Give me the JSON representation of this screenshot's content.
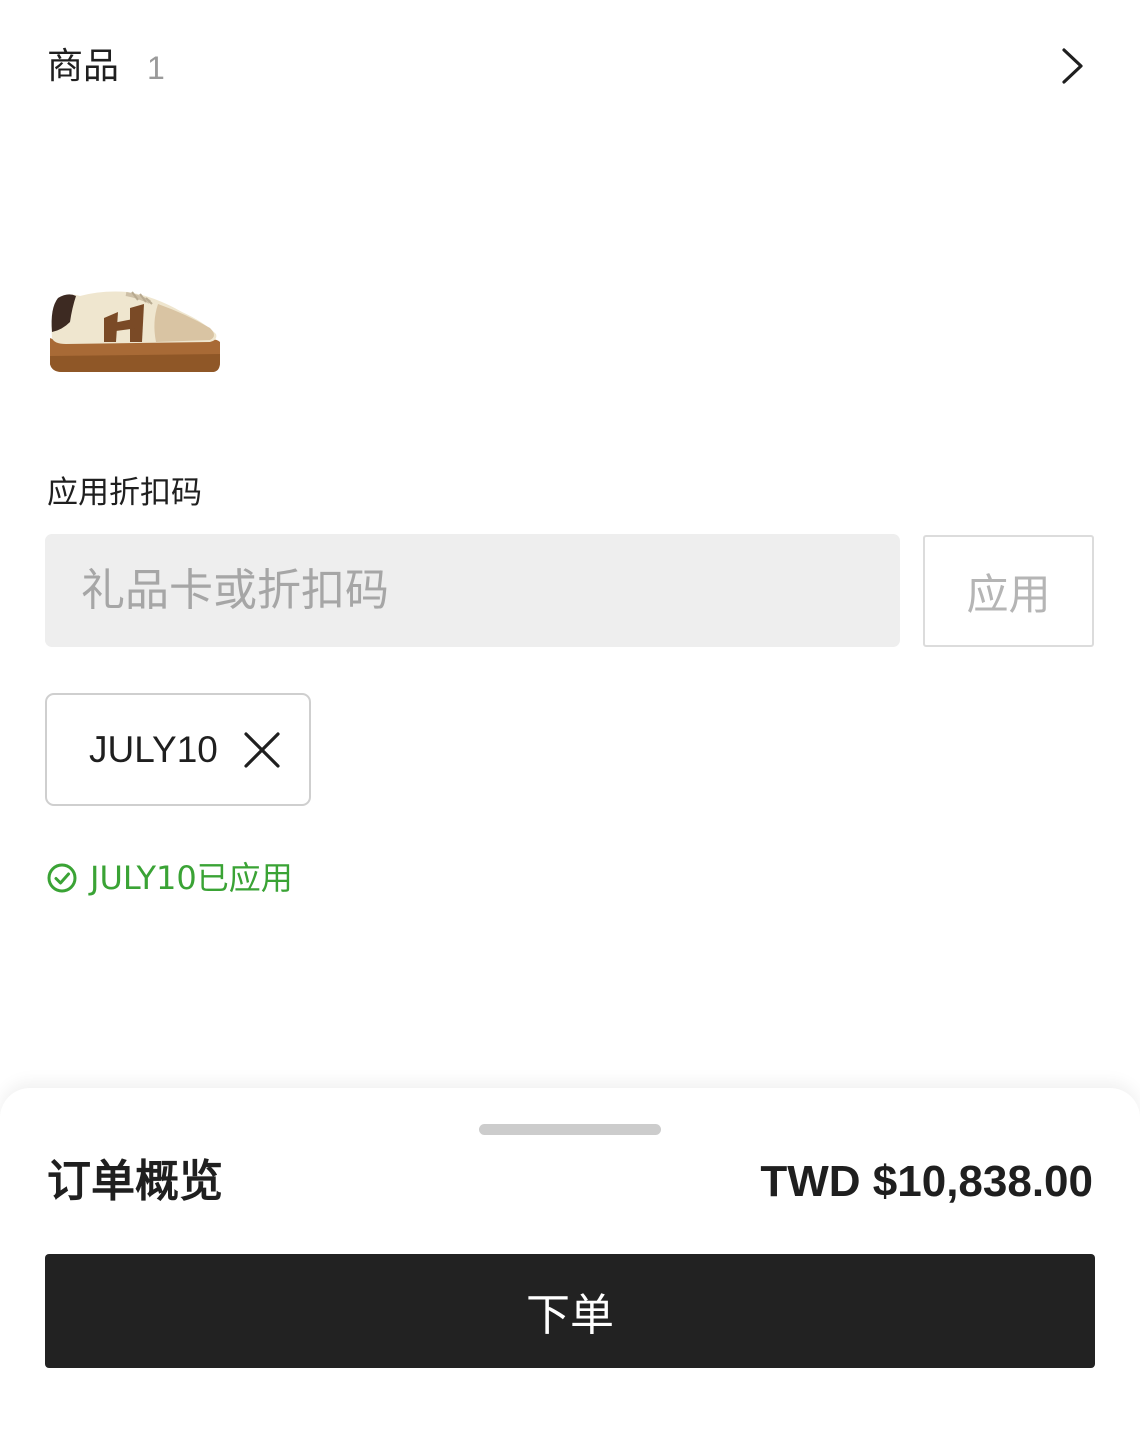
{
  "items": {
    "title": "商品",
    "count": "1",
    "chevron_icon": "chevron-right-icon",
    "product_image_icon": "sneaker-image"
  },
  "discount": {
    "label": "应用折扣码",
    "input_placeholder": "礼品卡或折扣码",
    "input_value": "",
    "apply_label": "应用",
    "applied_code": "JULY10",
    "remove_icon": "close-icon",
    "applied_message": "JULY10已应用",
    "applied_icon": "check-circle-icon",
    "success_color": "#3aa335"
  },
  "summary": {
    "title": "订单概览",
    "total": "TWD $10,838.00",
    "place_order_label": "下单",
    "button_color": "#222222"
  }
}
